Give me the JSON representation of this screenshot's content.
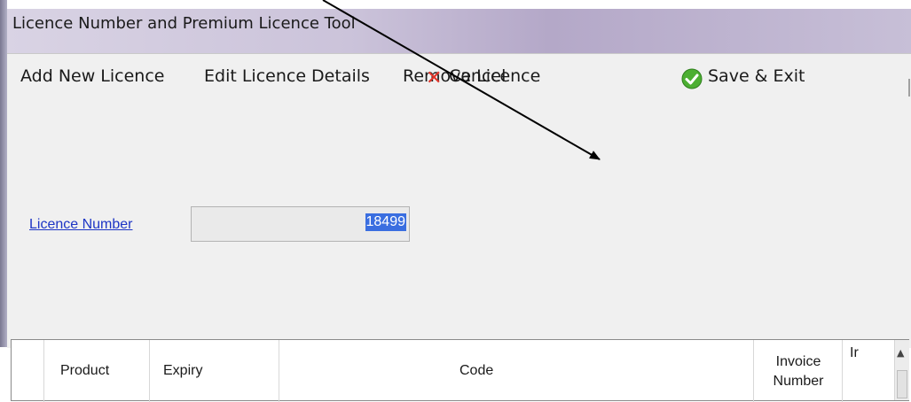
{
  "window": {
    "title": "Licence Number and Premium Licence Tool"
  },
  "toolbar": {
    "add_label": "Add New Licence",
    "edit_label": "Edit Licence Details",
    "remove_label": "Remove Licence",
    "cancel_label": "Cancel",
    "save_label": "Save & Exit",
    "cancel_icon": "cancel-icon",
    "save_icon": "checkmark-icon"
  },
  "form": {
    "licence_number_label": "Licence Number",
    "licence_number_value": "18499"
  },
  "grid": {
    "columns": [
      "",
      "Product",
      "Expiry",
      "Code",
      "Invoice Number",
      "Ir"
    ]
  },
  "colors": {
    "link": "#1d35c5",
    "selection": "#3a6ee0",
    "cancel_red": "#e0352a",
    "save_green": "#4caf32"
  }
}
